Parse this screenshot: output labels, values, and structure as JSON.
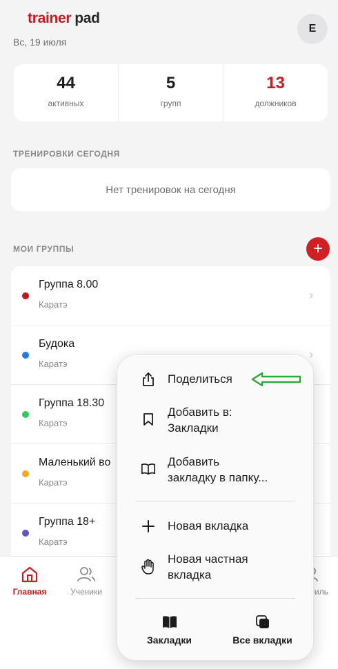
{
  "app": {
    "logo_part1": "trainer",
    "logo_part2": "pad",
    "date": "Вс, 19 июля",
    "avatar_initial": "E"
  },
  "stats": [
    {
      "value": "44",
      "label": "активных"
    },
    {
      "value": "5",
      "label": "групп"
    },
    {
      "value": "13",
      "label": "должников"
    }
  ],
  "today": {
    "title": "ТРЕНИРОВКИ СЕГОДНЯ",
    "empty_text": "Нет тренировок на сегодня"
  },
  "groups": {
    "title": "МОИ ГРУППЫ",
    "add_label": "+",
    "items": [
      {
        "name": "Группа 8.00",
        "sport": "Каратэ",
        "color": "#c0161c"
      },
      {
        "name": "Будока",
        "sport": "Каратэ",
        "color": "#1e7be6"
      },
      {
        "name": "Группа 18.30",
        "sport": "Каратэ",
        "color": "#34c759"
      },
      {
        "name": "Маленький во",
        "sport": "Каратэ",
        "color": "#f5a623"
      },
      {
        "name": "Группа 18+",
        "sport": "Каратэ",
        "color": "#5b55c8"
      }
    ]
  },
  "tabbar": {
    "home": "Главная",
    "students": "Ученики",
    "profile_partial": "филь"
  },
  "context_menu": {
    "share": "Поделиться",
    "add_bookmark_line1": "Добавить в:",
    "add_bookmark_line2": "Закладки",
    "add_folder_line1": "Добавить",
    "add_folder_line2": "закладку в папку...",
    "new_tab": "Новая вкладка",
    "new_private_line1": "Новая частная",
    "new_private_line2": "вкладка",
    "bookmarks": "Закладки",
    "all_tabs": "Все вкладки"
  },
  "colors": {
    "brand_red": "#c81b20",
    "annotation_arrow": "#2ea836"
  }
}
